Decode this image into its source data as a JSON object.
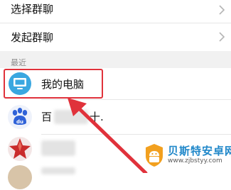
{
  "menu": {
    "select_group": "选择群聊",
    "start_group": "发起群聊"
  },
  "section": {
    "recent_label": "最近"
  },
  "contacts": [
    {
      "name": "我的电脑",
      "icon": "computer-icon",
      "color": "#3aa7e0"
    },
    {
      "name": "百",
      "name_suffix": "十.",
      "icon": "baidu-paw-icon",
      "color": "#2f62d8"
    },
    {
      "name": "",
      "icon": "red-star-icon",
      "color": "#c92b2b"
    }
  ],
  "watermark": {
    "title": "贝斯特安卓网",
    "url": "www.zjbstyy.com"
  },
  "colors": {
    "highlight": "#e0323b",
    "accent": "#3aa7e0"
  }
}
